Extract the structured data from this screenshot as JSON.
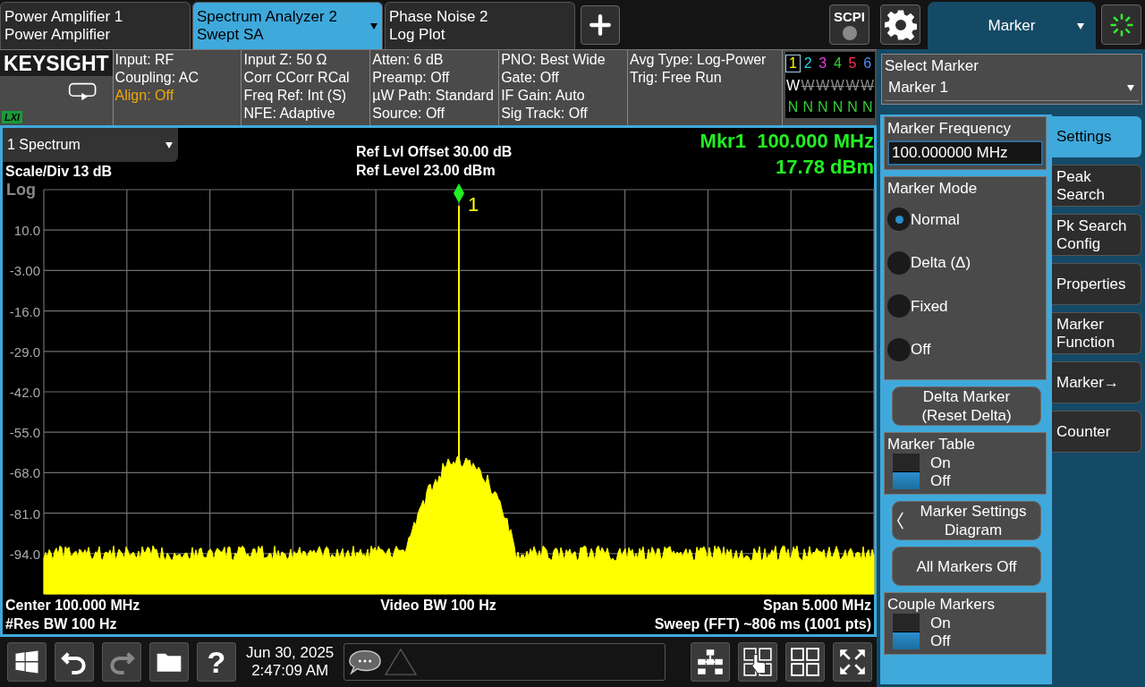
{
  "instrument_tabs": [
    {
      "title": "Power Amplifier 1",
      "subtitle": "Power Amplifier",
      "selected": false
    },
    {
      "title": "Spectrum Analyzer 2",
      "subtitle": "Swept SA",
      "selected": true
    },
    {
      "title": "Phase Noise 2",
      "subtitle": "Log Plot",
      "selected": false
    }
  ],
  "scpi": {
    "label": "SCPI"
  },
  "menu_tab": {
    "label": "Marker"
  },
  "brand": {
    "logo": "KEYSIGHT",
    "badge": "LXI"
  },
  "settings_columns": [
    [
      {
        "text": "Input: RF",
        "warning": false
      },
      {
        "text": "Coupling: AC",
        "warning": false
      },
      {
        "text": "Align: Off",
        "warning": true
      }
    ],
    [
      {
        "text": "Input Z: 50 Ω",
        "warning": false
      },
      {
        "text": "Corr CCorr RCal",
        "warning": false
      },
      {
        "text": "Freq Ref: Int (S)",
        "warning": false
      },
      {
        "text": "NFE: Adaptive",
        "warning": false
      }
    ],
    [
      {
        "text": "Atten: 6 dB",
        "warning": false
      },
      {
        "text": "Preamp: Off",
        "warning": false
      },
      {
        "text": "µW Path: Standard",
        "warning": false
      },
      {
        "text": "Source: Off",
        "warning": false
      }
    ],
    [
      {
        "text": "PNO: Best Wide",
        "warning": false
      },
      {
        "text": "Gate: Off",
        "warning": false
      },
      {
        "text": "IF Gain: Auto",
        "warning": false
      },
      {
        "text": "Sig Track: Off",
        "warning": false
      }
    ],
    [
      {
        "text": "Avg Type: Log-Power",
        "warning": false
      },
      {
        "text": "Trig: Free Run",
        "warning": false
      }
    ]
  ],
  "traces": [
    {
      "number": "1",
      "color": "#ffff00",
      "selected": true,
      "type": "W",
      "active": true,
      "detector": "N"
    },
    {
      "number": "2",
      "color": "#22d3ee",
      "selected": false,
      "type": "W",
      "active": false,
      "detector": "N"
    },
    {
      "number": "3",
      "color": "#e040e0",
      "selected": false,
      "type": "W",
      "active": false,
      "detector": "N"
    },
    {
      "number": "4",
      "color": "#33cc33",
      "selected": false,
      "type": "W",
      "active": false,
      "detector": "N"
    },
    {
      "number": "5",
      "color": "#ff3355",
      "selected": false,
      "type": "W",
      "active": false,
      "detector": "N"
    },
    {
      "number": "6",
      "color": "#4a8cff",
      "selected": false,
      "type": "W",
      "active": false,
      "detector": "N"
    }
  ],
  "graph": {
    "window_select": "1 Spectrum",
    "scale": "Scale/Div 13 dB",
    "scale_type": "Log",
    "ref_offset": "Ref Lvl Offset 30.00 dB",
    "ref_level": "Ref Level 23.00 dBm",
    "marker_frequency": "Mkr1  100.000 MHz",
    "marker_amplitude": "17.78 dBm",
    "marker_label": "1",
    "y_labels": [
      "10.0",
      "-3.00",
      "-16.0",
      "-29.0",
      "-42.0",
      "-55.0",
      "-68.0",
      "-81.0",
      "-94.0"
    ],
    "center": "Center 100.000 MHz",
    "video_bw": "Video BW 100 Hz",
    "span": "Span 5.000 MHz",
    "res_bw": "#Res BW 100 Hz",
    "sweep": "Sweep (FFT) ~806 ms  (1001 pts)"
  },
  "taskbar": {
    "help": "?",
    "date": "Jun 30, 2025",
    "time": "2:47:09 AM"
  },
  "marker_panel": {
    "select_label": "Select Marker",
    "select_value": "Marker 1",
    "controls": [
      {
        "kind": "field",
        "label": "Marker Frequency",
        "value": "100.000000 MHz"
      },
      {
        "kind": "radio_group",
        "label": "Marker Mode",
        "options": [
          {
            "label": "Normal",
            "selected": true
          },
          {
            "label": "Delta (Δ)",
            "selected": false
          },
          {
            "label": "Fixed",
            "selected": false
          },
          {
            "label": "Off",
            "selected": false
          }
        ]
      },
      {
        "kind": "button",
        "label": "Delta Marker (Reset Delta)"
      },
      {
        "kind": "toggle",
        "label": "Marker Table",
        "options": [
          {
            "label": "On",
            "selected": false
          },
          {
            "label": "Off",
            "selected": true
          }
        ]
      },
      {
        "kind": "nav_button",
        "label": "Marker Settings Diagram"
      },
      {
        "kind": "button",
        "label": "All Markers Off"
      },
      {
        "kind": "toggle",
        "label": "Couple Markers",
        "options": [
          {
            "label": "On",
            "selected": false
          },
          {
            "label": "Off",
            "selected": true
          }
        ]
      }
    ]
  },
  "side_tabs": [
    {
      "label": "Settings",
      "selected": true
    },
    {
      "label": "Peak Search",
      "selected": false
    },
    {
      "label": "Pk Search Config",
      "selected": false
    },
    {
      "label": "Properties",
      "selected": false
    },
    {
      "label": "Marker Function",
      "selected": false
    },
    {
      "label": "Marker→",
      "selected": false
    },
    {
      "label": "Counter",
      "selected": false
    }
  ]
}
